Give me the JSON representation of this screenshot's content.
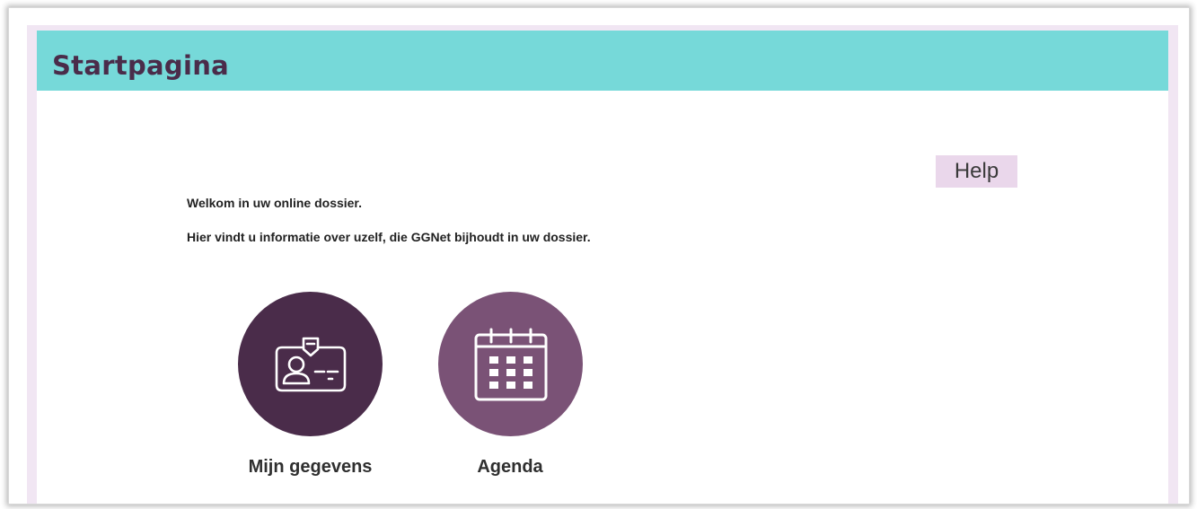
{
  "header": {
    "title": "Startpagina"
  },
  "help": {
    "label": "Help"
  },
  "intro": {
    "line1": "Welkom in uw online dossier.",
    "line2": "Hier vindt u informatie over uzelf, die GGNet bijhoudt in uw dossier."
  },
  "tiles": [
    {
      "label": "Mijn gegevens",
      "icon": "id-card-icon",
      "color": "#4a2c4a"
    },
    {
      "label": "Agenda",
      "icon": "calendar-icon",
      "color": "#7a5276"
    }
  ],
  "colors": {
    "header_bg": "#76d9d9",
    "title_text": "#4a2c4a",
    "page_border": "#f1e6f3",
    "help_bg": "#ead7eb"
  }
}
